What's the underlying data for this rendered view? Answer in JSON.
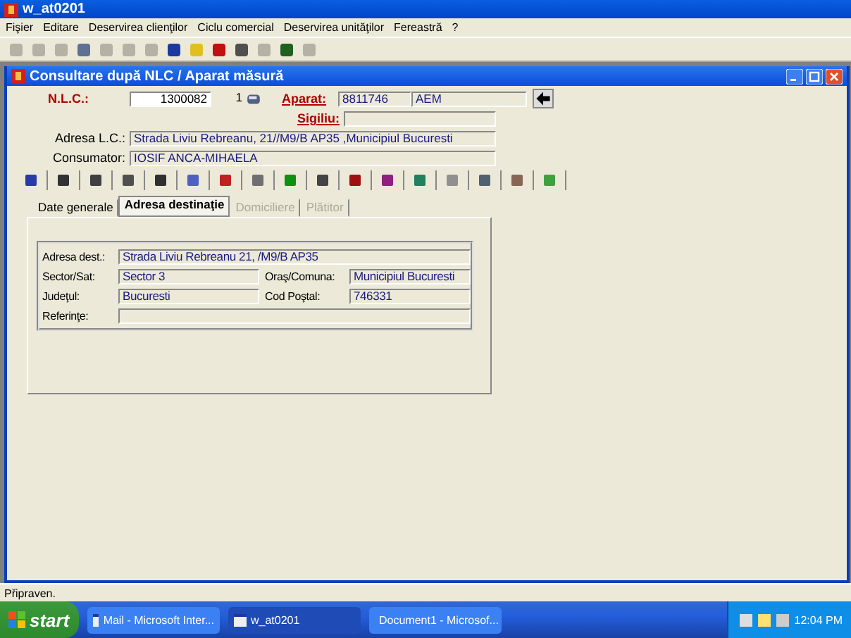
{
  "app_window": {
    "title": "w_at0201"
  },
  "menu": [
    "Fişier",
    "Editare",
    "Deservirea clienţilor",
    "Ciclu comercial",
    "Deservirea unităţilor",
    "Fereastră",
    "?"
  ],
  "child_window": {
    "title": "Consultare după NLC / Aparat măsură"
  },
  "header": {
    "nlc_label": "N.L.C.:",
    "nlc_value": "1300082",
    "nlc_index": "1",
    "aparat_label": "Aparat:",
    "aparat_serial": "8811746",
    "aparat_type": "AEM",
    "sigiliu_label": "Sigiliu:",
    "adresa_label": "Adresa L.C.:",
    "adresa_value": "Strada Liviu Rebreanu, 21//M9/B AP35 ,Municipiul Bucuresti",
    "consumator_label": "Consumator:",
    "consumator_value": "IOSIF  ANCA-MIHAELA"
  },
  "tabs": [
    {
      "label": "Date generale",
      "selected": false,
      "disabled": false
    },
    {
      "label": "Adresa destinaţie",
      "selected": true,
      "disabled": false
    },
    {
      "label": "Domiciliere",
      "selected": false,
      "disabled": true
    },
    {
      "label": "Plătitor",
      "selected": false,
      "disabled": true
    }
  ],
  "address": {
    "adresa_label": "Adresa dest.:",
    "adresa_value": "Strada Liviu Rebreanu 21,  /M9/B AP35",
    "sector_label": "Sector/Sat:",
    "sector_value": "Sector 3",
    "oras_label": "Oraş/Comuna:",
    "oras_value": "Municipiul Bucuresti",
    "judet_label": "Judeţul:",
    "judet_value": "Bucuresti",
    "cod_label": "Cod Poştal:",
    "cod_value": "746331",
    "referinte_label": "Referinţe:"
  },
  "status_bar": "Připraven.",
  "taskbar": {
    "start": "start",
    "tasks": [
      {
        "label": "Mail - Microsoft Inter...",
        "selected": false
      },
      {
        "label": "w_at0201",
        "selected": true
      },
      {
        "label": "Document1 - Microsof...",
        "selected": false
      }
    ],
    "clock": "12:04 PM"
  }
}
